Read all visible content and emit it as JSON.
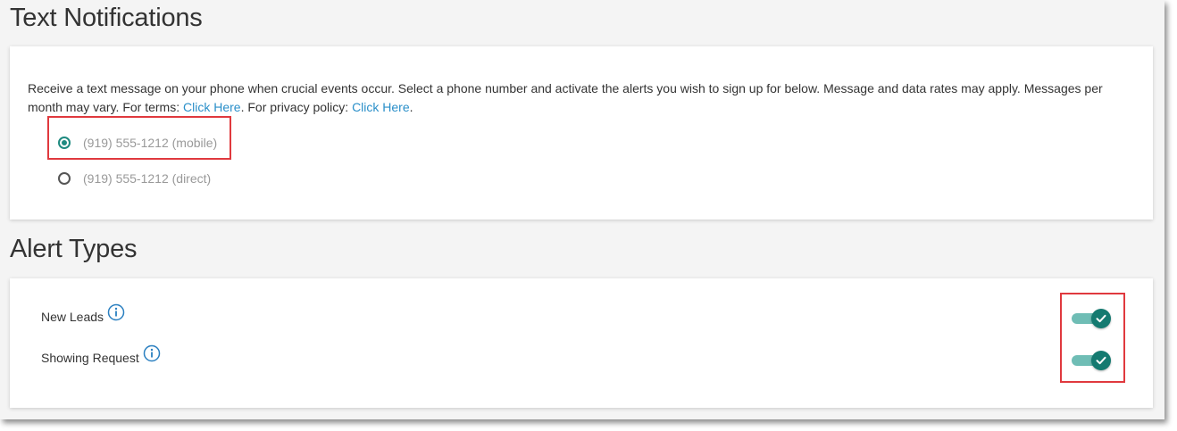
{
  "text_notifications": {
    "title": "Text Notifications",
    "description": {
      "intro": "Receive a text message on your phone when crucial events occur. Select a phone number and activate the alerts you wish to sign up for below. Message and data rates may apply. Messages per month may vary. For terms: ",
      "terms_link": "Click Here",
      "privacy_text": ". For privacy policy: ",
      "privacy_link": "Click Here",
      "end": "."
    },
    "phone_options": [
      {
        "label": "(919) 555-1212 (mobile)",
        "selected": true
      },
      {
        "label": "(919) 555-1212 (direct)",
        "selected": false
      }
    ]
  },
  "alert_types": {
    "title": "Alert Types",
    "alerts": [
      {
        "label": "New Leads",
        "enabled": true,
        "icon": "info-icon"
      },
      {
        "label": "Showing Request",
        "enabled": true,
        "icon": "info-icon"
      }
    ]
  },
  "colors": {
    "accent": "#1f8a80",
    "toggle_track": "#6fbdb5",
    "link": "#2a8fc9",
    "highlight": "#e0393e"
  }
}
